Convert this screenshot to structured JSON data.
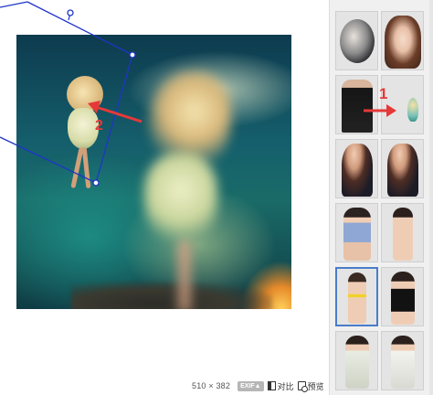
{
  "status_bar": {
    "dimensions": "510 × 382",
    "exif_label": "EXIF▲",
    "compare_label": "对比",
    "preview_label": "预览"
  },
  "annotations": {
    "step_1": "1",
    "step_2": "2",
    "arrow_color": "#e53939",
    "bbox_color": "#1f35c7"
  },
  "thumbnails": [
    {
      "name": "couple-suit-oval",
      "selected": false
    },
    {
      "name": "anime-girl-brown-hair",
      "selected": false
    },
    {
      "name": "couple-black-suits",
      "selected": false
    },
    {
      "name": "fairy-girl-cutout",
      "selected": false
    },
    {
      "name": "woman-dark-top-1",
      "selected": false
    },
    {
      "name": "woman-dark-top-2",
      "selected": false
    },
    {
      "name": "woman-denim-shirt",
      "selected": false
    },
    {
      "name": "woman-bikini-standing",
      "selected": false
    },
    {
      "name": "woman-yellow-bikini",
      "selected": true
    },
    {
      "name": "woman-black-dress",
      "selected": false
    },
    {
      "name": "woman-white-dress-1",
      "selected": false
    },
    {
      "name": "woman-white-dress-2",
      "selected": false
    }
  ],
  "colors": {
    "accent_selected": "#4a7cc9",
    "panel_bg": "#f0f0f0"
  }
}
